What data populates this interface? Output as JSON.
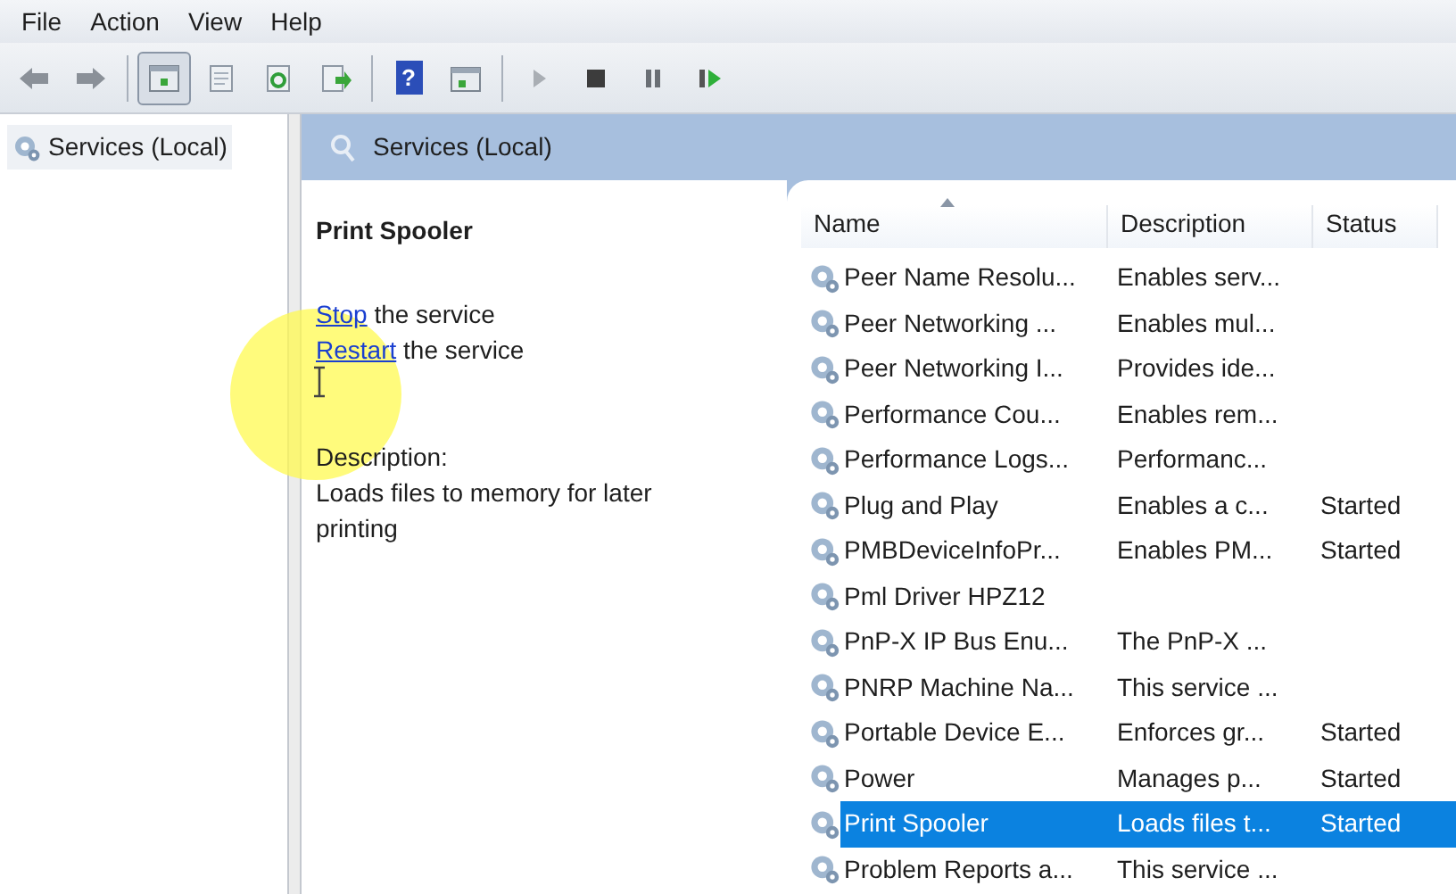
{
  "menu": [
    "File",
    "Action",
    "View",
    "Help"
  ],
  "toolbar": [
    {
      "kind": "back",
      "pressed": false
    },
    {
      "kind": "forward",
      "pressed": false
    },
    {
      "kind": "sep"
    },
    {
      "kind": "console",
      "pressed": true
    },
    {
      "kind": "properties",
      "pressed": false
    },
    {
      "kind": "refresh",
      "pressed": false
    },
    {
      "kind": "export",
      "pressed": false
    },
    {
      "kind": "sep"
    },
    {
      "kind": "help",
      "pressed": false,
      "label": "?"
    },
    {
      "kind": "actionpane",
      "pressed": false
    },
    {
      "kind": "sep"
    },
    {
      "kind": "play",
      "pressed": false
    },
    {
      "kind": "stop",
      "pressed": false
    },
    {
      "kind": "pause",
      "pressed": false
    },
    {
      "kind": "restart",
      "pressed": false
    }
  ],
  "tree": {
    "items": [
      {
        "label": "Services (Local)",
        "selected": false
      }
    ]
  },
  "pane_title": "Services (Local)",
  "details": {
    "title": "Print Spooler",
    "actions": [
      {
        "link": "Stop",
        "text": " the service"
      },
      {
        "link": "Restart",
        "text": " the service"
      }
    ],
    "description_label": "Description:",
    "description": "Loads files to memory for later printing"
  },
  "table": {
    "columns": [
      "Name",
      "Description",
      "Status"
    ],
    "rows": [
      {
        "name": "Peer Name Resolu...",
        "description": "Enables serv...",
        "status": "",
        "selected": false
      },
      {
        "name": "Peer Networking ...",
        "description": "Enables mul...",
        "status": "",
        "selected": false
      },
      {
        "name": "Peer Networking I...",
        "description": "Provides ide...",
        "status": "",
        "selected": false
      },
      {
        "name": "Performance Cou...",
        "description": "Enables rem...",
        "status": "",
        "selected": false
      },
      {
        "name": "Performance Logs...",
        "description": "Performanc...",
        "status": "",
        "selected": false
      },
      {
        "name": "Plug and Play",
        "description": "Enables a c...",
        "status": "Started",
        "selected": false
      },
      {
        "name": "PMBDeviceInfoPr...",
        "description": "Enables PM...",
        "status": "Started",
        "selected": false
      },
      {
        "name": "Pml Driver HPZ12",
        "description": "",
        "status": "",
        "selected": false
      },
      {
        "name": "PnP-X IP Bus Enu...",
        "description": "The PnP-X ...",
        "status": "",
        "selected": false
      },
      {
        "name": "PNRP Machine Na...",
        "description": "This service ...",
        "status": "",
        "selected": false
      },
      {
        "name": "Portable Device E...",
        "description": "Enforces gr...",
        "status": "Started",
        "selected": false
      },
      {
        "name": "Power",
        "description": "Manages p...",
        "status": "Started",
        "selected": false
      },
      {
        "name": "Print Spooler",
        "description": "Loads files t...",
        "status": "Started",
        "selected": true
      },
      {
        "name": "Problem Reports a...",
        "description": "This service ...",
        "status": "",
        "selected": false
      }
    ]
  }
}
